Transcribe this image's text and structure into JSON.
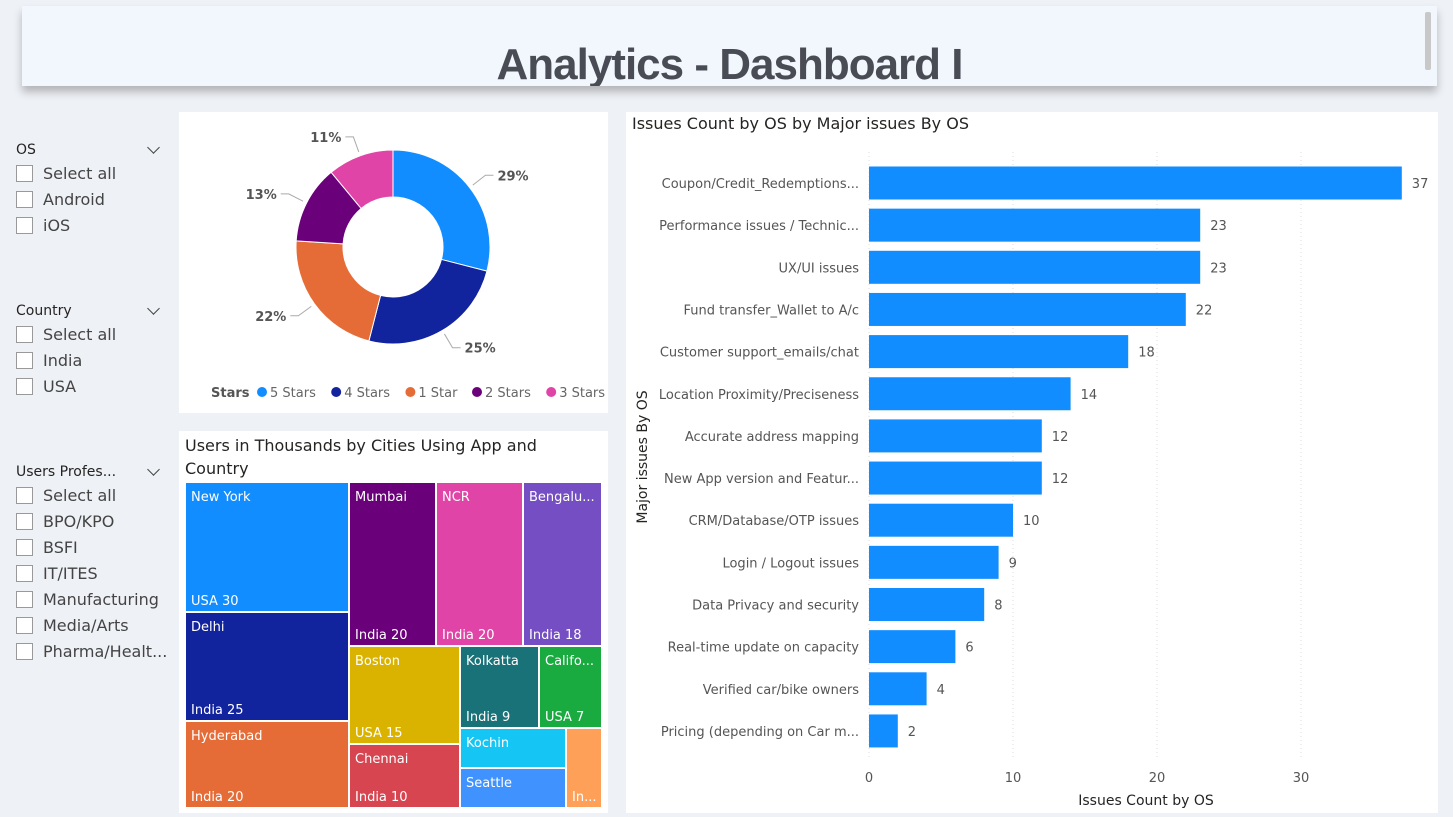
{
  "header": {
    "title": "Analytics - Dashboard I"
  },
  "filters": [
    {
      "title": "OS",
      "options": [
        "Select all",
        "Android",
        "iOS"
      ]
    },
    {
      "title": "Country",
      "options": [
        "Select all",
        "India",
        "USA"
      ]
    },
    {
      "title": "Users Profes...",
      "options": [
        "Select all",
        "BPO/KPO",
        "BSFI",
        "IT/ITES",
        "Manufacturing",
        "Media/Arts",
        "Pharma/Healt..."
      ]
    }
  ],
  "chart_data": [
    {
      "type": "pie",
      "donut": true,
      "legend_title": "Stars",
      "legend_position": "bottom",
      "slices": [
        {
          "name": "5 Stars",
          "value": 29,
          "label": "29%",
          "color": "#118DFF"
        },
        {
          "name": "4 Stars",
          "value": 25,
          "label": "25%",
          "color": "#12239E"
        },
        {
          "name": "1 Star",
          "value": 22,
          "label": "22%",
          "color": "#E66C37"
        },
        {
          "name": "2 Stars",
          "value": 13,
          "label": "13%",
          "color": "#6B007B"
        },
        {
          "name": "3 Stars",
          "value": 11,
          "label": "11%",
          "color": "#E044A7"
        }
      ]
    },
    {
      "type": "treemap",
      "title": "Users in Thousands by Cities Using App and Country",
      "items": [
        {
          "city": "New York",
          "label": "USA 30",
          "color": "#118DFF"
        },
        {
          "city": "Delhi",
          "label": "India 25",
          "color": "#12239E"
        },
        {
          "city": "Hyderabad",
          "label": "India 20",
          "color": "#E66C37"
        },
        {
          "city": "Mumbai",
          "label": "India 20",
          "color": "#6B007B"
        },
        {
          "city": "NCR",
          "label": "India 20",
          "color": "#E044A7"
        },
        {
          "city": "Bengalu...",
          "label": "India 18",
          "color": "#744EC2"
        },
        {
          "city": "Boston",
          "label": "USA 15",
          "color": "#D9B300"
        },
        {
          "city": "Chennai",
          "label": "India 10",
          "color": "#D64550"
        },
        {
          "city": "Kolkatta",
          "label": "India 9",
          "color": "#197278"
        },
        {
          "city": "Califo...",
          "label": "USA 7",
          "color": "#1AAB40"
        },
        {
          "city": "Kochin",
          "label": "",
          "color": "#15C6F4"
        },
        {
          "city": "Seattle",
          "label": "",
          "color": "#4092FF"
        },
        {
          "city": "",
          "label": "In...",
          "color": "#FFA058"
        }
      ]
    },
    {
      "type": "bar",
      "orientation": "horizontal",
      "title": "Issues Count by OS by Major issues By OS",
      "xlabel": "Issues Count by OS",
      "ylabel": "Major issues By OS",
      "xlim": [
        0,
        37
      ],
      "xticks": [
        0,
        10,
        20,
        30
      ],
      "grid": true,
      "color": "#118DFF",
      "categories": [
        "Coupon/Credit_Redemptions...",
        "Performance issues / Technic...",
        "UX/UI issues",
        "Fund transfer_Wallet to A/c",
        "Customer support_emails/chat",
        "Location Proximity/Preciseness",
        "Accurate address mapping",
        "New App version and Featur...",
        "CRM/Database/OTP issues",
        "Login / Logout issues",
        "Data Privacy and security",
        "Real-time update on capacity",
        "Verified car/bike owners",
        "Pricing (depending on Car m..."
      ],
      "values": [
        37,
        23,
        23,
        22,
        18,
        14,
        12,
        12,
        10,
        9,
        8,
        6,
        4,
        2
      ]
    }
  ]
}
